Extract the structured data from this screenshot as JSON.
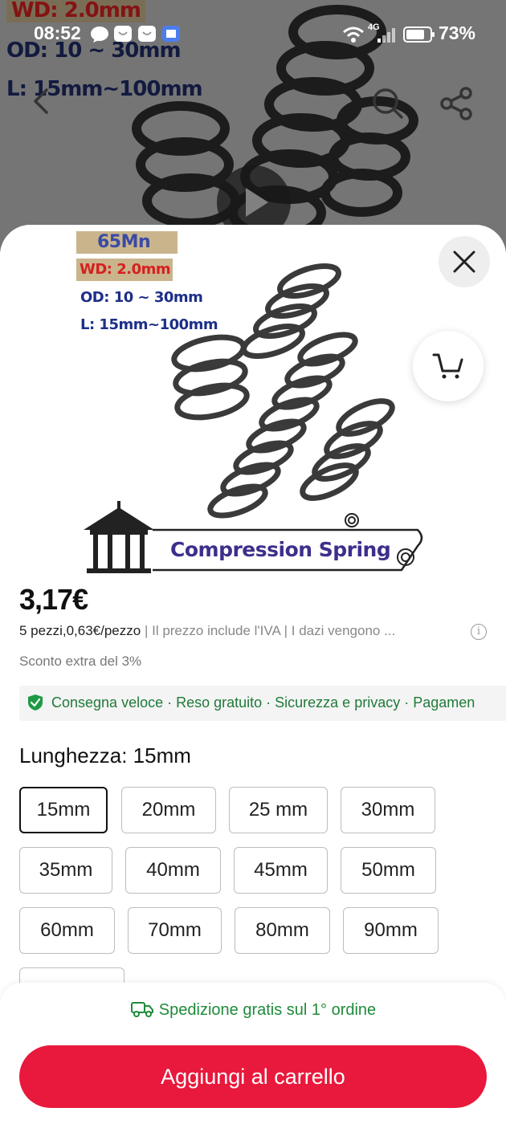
{
  "status_bar": {
    "time": "08:52",
    "network": "4G",
    "battery": "73%"
  },
  "background": {
    "spec_wd": "WD: 2.0mm",
    "spec_od": "OD: 10 ~ 30mm",
    "spec_l": "L: 15mm~100mm",
    "icons": [
      "back-icon",
      "search-icon",
      "share-icon",
      "play-icon"
    ]
  },
  "product_image": {
    "material": "65Mn",
    "wd": "WD: 2.0mm",
    "od": "OD: 10 ~ 30mm",
    "length": "L: 15mm~100mm",
    "banner": "Compression Spring"
  },
  "price": {
    "amount": "3,17€",
    "unit_info": "5 pezzi,0,63€/pezzo",
    "vat_note": "Il prezzo include l'IVA",
    "duties_note": "I dazi vengono ...",
    "discount": "Sconto extra del 3%"
  },
  "assurance": {
    "text": "Consegna veloce · Reso gratuito · Sicurezza e privacy · Pagamen"
  },
  "variant": {
    "label": "Lunghezza: 15mm",
    "selected": "15mm",
    "options": [
      "15mm",
      "20mm",
      "25 mm",
      "30mm",
      "35mm",
      "40mm",
      "45mm",
      "50mm",
      "60mm",
      "70mm",
      "80mm",
      "90mm"
    ]
  },
  "bottom": {
    "shipping": "Spedizione gratis sul 1° ordine",
    "add_to_cart": "Aggiungi al carrello"
  },
  "colors": {
    "accent": "#e8193c",
    "green": "#1f8a3a"
  }
}
